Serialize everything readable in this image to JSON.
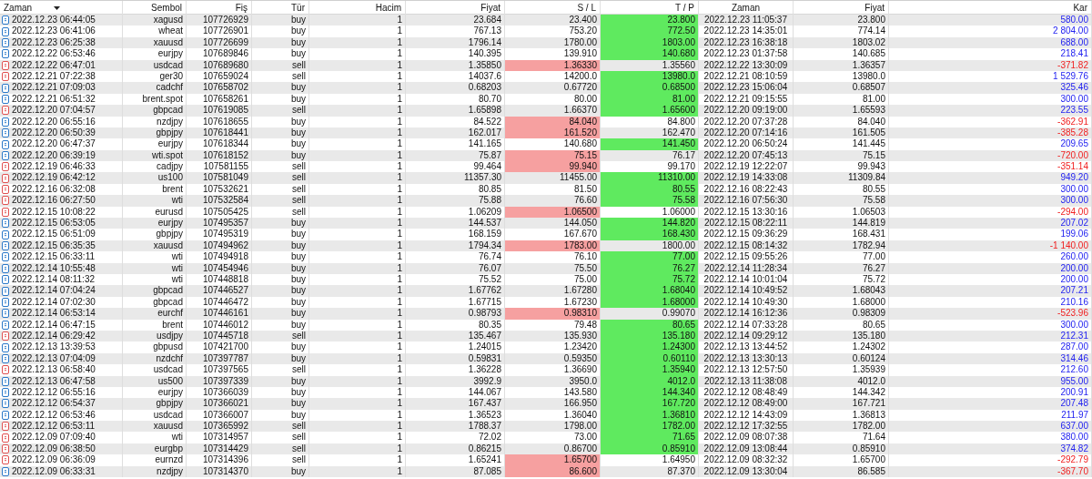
{
  "table": {
    "columns": [
      "Zaman",
      "Sembol",
      "Fiş",
      "Tür",
      "Hacim",
      "Fiyat",
      "S / L",
      "T / P",
      "Zaman",
      "Fiyat",
      "Kar"
    ],
    "rows": [
      {
        "kind": "buy",
        "sl_hit": false,
        "tp_hit": true,
        "loss": false,
        "cells": [
          "2022.12.23 06:44:05",
          "xagusd",
          "107726929",
          "buy",
          "1",
          "23.684",
          "23.400",
          "23.800",
          "2022.12.23 11:05:37",
          "23.800",
          "580.00"
        ]
      },
      {
        "kind": "buy",
        "sl_hit": false,
        "tp_hit": true,
        "loss": false,
        "cells": [
          "2022.12.23 06:41:06",
          "wheat",
          "107726901",
          "buy",
          "1",
          "767.13",
          "753.20",
          "772.50",
          "2022.12.23 14:35:01",
          "774.14",
          "2 804.00"
        ]
      },
      {
        "kind": "buy",
        "sl_hit": false,
        "tp_hit": true,
        "loss": false,
        "cells": [
          "2022.12.23 06:25:38",
          "xauusd",
          "107726699",
          "buy",
          "1",
          "1796.14",
          "1780.00",
          "1803.00",
          "2022.12.23 16:38:18",
          "1803.02",
          "688.00"
        ]
      },
      {
        "kind": "buy",
        "sl_hit": false,
        "tp_hit": true,
        "loss": false,
        "cells": [
          "2022.12.22 06:53:46",
          "eurjpy",
          "107689846",
          "buy",
          "1",
          "140.395",
          "139.910",
          "140.680",
          "2022.12.23 01:37:58",
          "140.685",
          "218.41"
        ]
      },
      {
        "kind": "sell",
        "sl_hit": true,
        "tp_hit": false,
        "loss": true,
        "cells": [
          "2022.12.22 06:47:01",
          "usdcad",
          "107689680",
          "sell",
          "1",
          "1.35850",
          "1.36330",
          "1.35560",
          "2022.12.22 13:30:09",
          "1.36357",
          "-371.82"
        ]
      },
      {
        "kind": "sell",
        "sl_hit": false,
        "tp_hit": true,
        "loss": false,
        "cells": [
          "2022.12.21 07:22:38",
          "ger30",
          "107659024",
          "sell",
          "1",
          "14037.6",
          "14200.0",
          "13980.0",
          "2022.12.21 08:10:59",
          "13980.0",
          "1 529.76"
        ]
      },
      {
        "kind": "buy",
        "sl_hit": false,
        "tp_hit": true,
        "loss": false,
        "cells": [
          "2022.12.21 07:09:03",
          "cadchf",
          "107658702",
          "buy",
          "1",
          "0.68203",
          "0.67720",
          "0.68500",
          "2022.12.23 15:06:04",
          "0.68507",
          "325.46"
        ]
      },
      {
        "kind": "buy",
        "sl_hit": false,
        "tp_hit": true,
        "loss": false,
        "cells": [
          "2022.12.21 06:51:32",
          "brent.spot",
          "107658261",
          "buy",
          "1",
          "80.70",
          "80.00",
          "81.00",
          "2022.12.21 09:15:55",
          "81.00",
          "300.00"
        ]
      },
      {
        "kind": "sell",
        "sl_hit": false,
        "tp_hit": true,
        "loss": false,
        "cells": [
          "2022.12.20 07:04:57",
          "gbpcad",
          "107619085",
          "sell",
          "1",
          "1.65898",
          "1.66370",
          "1.65600",
          "2022.12.20 09:19:00",
          "1.65593",
          "223.55"
        ]
      },
      {
        "kind": "buy",
        "sl_hit": true,
        "tp_hit": false,
        "loss": true,
        "cells": [
          "2022.12.20 06:55:16",
          "nzdjpy",
          "107618655",
          "buy",
          "1",
          "84.522",
          "84.040",
          "84.800",
          "2022.12.20 07:37:28",
          "84.040",
          "-362.91"
        ]
      },
      {
        "kind": "buy",
        "sl_hit": true,
        "tp_hit": false,
        "loss": true,
        "cells": [
          "2022.12.20 06:50:39",
          "gbpjpy",
          "107618441",
          "buy",
          "1",
          "162.017",
          "161.520",
          "162.470",
          "2022.12.20 07:14:16",
          "161.505",
          "-385.28"
        ]
      },
      {
        "kind": "buy",
        "sl_hit": false,
        "tp_hit": true,
        "loss": false,
        "cells": [
          "2022.12.20 06:47:37",
          "eurjpy",
          "107618344",
          "buy",
          "1",
          "141.165",
          "140.680",
          "141.450",
          "2022.12.20 06:50:24",
          "141.445",
          "209.65"
        ]
      },
      {
        "kind": "buy",
        "sl_hit": true,
        "tp_hit": false,
        "loss": true,
        "cells": [
          "2022.12.20 06:39:19",
          "wti.spot",
          "107618152",
          "buy",
          "1",
          "75.87",
          "75.15",
          "76.17",
          "2022.12.20 07:45:13",
          "75.15",
          "-720.00"
        ]
      },
      {
        "kind": "sell",
        "sl_hit": true,
        "tp_hit": false,
        "loss": true,
        "cells": [
          "2022.12.19 06:46:33",
          "cadjpy",
          "107581155",
          "sell",
          "1",
          "99.464",
          "99.940",
          "99.170",
          "2022.12.19 12:22:07",
          "99.943",
          "-351.14"
        ]
      },
      {
        "kind": "sell",
        "sl_hit": false,
        "tp_hit": true,
        "loss": false,
        "cells": [
          "2022.12.19 06:42:12",
          "us100",
          "107581049",
          "sell",
          "1",
          "11357.30",
          "11455.00",
          "11310.00",
          "2022.12.19 14:33:08",
          "11309.84",
          "949.20"
        ]
      },
      {
        "kind": "sell",
        "sl_hit": false,
        "tp_hit": true,
        "loss": false,
        "cells": [
          "2022.12.16 06:32:08",
          "brent",
          "107532621",
          "sell",
          "1",
          "80.85",
          "81.50",
          "80.55",
          "2022.12.16 08:22:43",
          "80.55",
          "300.00"
        ]
      },
      {
        "kind": "sell",
        "sl_hit": false,
        "tp_hit": true,
        "loss": false,
        "cells": [
          "2022.12.16 06:27:50",
          "wti",
          "107532584",
          "sell",
          "1",
          "75.88",
          "76.60",
          "75.58",
          "2022.12.16 07:56:30",
          "75.58",
          "300.00"
        ]
      },
      {
        "kind": "sell",
        "sl_hit": true,
        "tp_hit": false,
        "loss": true,
        "cells": [
          "2022.12.15 10:08:22",
          "eurusd",
          "107505425",
          "sell",
          "1",
          "1.06209",
          "1.06500",
          "1.06000",
          "2022.12.15 13:30:16",
          "1.06503",
          "-294.00"
        ]
      },
      {
        "kind": "buy",
        "sl_hit": false,
        "tp_hit": true,
        "loss": false,
        "cells": [
          "2022.12.15 06:53:05",
          "eurjpy",
          "107495357",
          "buy",
          "1",
          "144.537",
          "144.050",
          "144.820",
          "2022.12.15 08:22:11",
          "144.819",
          "207.02"
        ]
      },
      {
        "kind": "buy",
        "sl_hit": false,
        "tp_hit": true,
        "loss": false,
        "cells": [
          "2022.12.15 06:51:09",
          "gbpjpy",
          "107495319",
          "buy",
          "1",
          "168.159",
          "167.670",
          "168.430",
          "2022.12.15 09:36:29",
          "168.431",
          "199.06"
        ]
      },
      {
        "kind": "buy",
        "sl_hit": true,
        "tp_hit": false,
        "loss": true,
        "cells": [
          "2022.12.15 06:35:35",
          "xauusd",
          "107494962",
          "buy",
          "1",
          "1794.34",
          "1783.00",
          "1800.00",
          "2022.12.15 08:14:32",
          "1782.94",
          "-1 140.00"
        ]
      },
      {
        "kind": "buy",
        "sl_hit": false,
        "tp_hit": true,
        "loss": false,
        "cells": [
          "2022.12.15 06:33:11",
          "wti",
          "107494918",
          "buy",
          "1",
          "76.74",
          "76.10",
          "77.00",
          "2022.12.15 09:55:26",
          "77.00",
          "260.00"
        ]
      },
      {
        "kind": "buy",
        "sl_hit": false,
        "tp_hit": true,
        "loss": false,
        "cells": [
          "2022.12.14 10:55:48",
          "wti",
          "107454946",
          "buy",
          "1",
          "76.07",
          "75.50",
          "76.27",
          "2022.12.14 11:28:34",
          "76.27",
          "200.00"
        ]
      },
      {
        "kind": "buy",
        "sl_hit": false,
        "tp_hit": true,
        "loss": false,
        "cells": [
          "2022.12.14 08:11:32",
          "wti",
          "107448818",
          "buy",
          "1",
          "75.52",
          "75.00",
          "75.72",
          "2022.12.14 10:01:04",
          "75.72",
          "200.00"
        ]
      },
      {
        "kind": "buy",
        "sl_hit": false,
        "tp_hit": true,
        "loss": false,
        "cells": [
          "2022.12.14 07:04:24",
          "gbpcad",
          "107446527",
          "buy",
          "1",
          "1.67762",
          "1.67280",
          "1.68040",
          "2022.12.14 10:49:52",
          "1.68043",
          "207.21"
        ]
      },
      {
        "kind": "buy",
        "sl_hit": false,
        "tp_hit": true,
        "loss": false,
        "cells": [
          "2022.12.14 07:02:30",
          "gbpcad",
          "107446472",
          "buy",
          "1",
          "1.67715",
          "1.67230",
          "1.68000",
          "2022.12.14 10:49:30",
          "1.68000",
          "210.16"
        ]
      },
      {
        "kind": "buy",
        "sl_hit": true,
        "tp_hit": false,
        "loss": true,
        "cells": [
          "2022.12.14 06:53:14",
          "eurchf",
          "107446161",
          "buy",
          "1",
          "0.98793",
          "0.98310",
          "0.99070",
          "2022.12.14 16:12:36",
          "0.98309",
          "-523.96"
        ]
      },
      {
        "kind": "buy",
        "sl_hit": false,
        "tp_hit": true,
        "loss": false,
        "cells": [
          "2022.12.14 06:47:15",
          "brent",
          "107446012",
          "buy",
          "1",
          "80.35",
          "79.48",
          "80.65",
          "2022.12.14 07:33:28",
          "80.65",
          "300.00"
        ]
      },
      {
        "kind": "sell",
        "sl_hit": false,
        "tp_hit": true,
        "loss": false,
        "cells": [
          "2022.12.14 06:29:42",
          "usdjpy",
          "107445718",
          "sell",
          "1",
          "135.467",
          "135.930",
          "135.180",
          "2022.12.14 09:29:12",
          "135.180",
          "212.31"
        ]
      },
      {
        "kind": "buy",
        "sl_hit": false,
        "tp_hit": true,
        "loss": false,
        "cells": [
          "2022.12.13 13:39:53",
          "gbpusd",
          "107421700",
          "buy",
          "1",
          "1.24015",
          "1.23420",
          "1.24300",
          "2022.12.13 13:44:52",
          "1.24302",
          "287.00"
        ]
      },
      {
        "kind": "buy",
        "sl_hit": false,
        "tp_hit": true,
        "loss": false,
        "cells": [
          "2022.12.13 07:04:09",
          "nzdchf",
          "107397787",
          "buy",
          "1",
          "0.59831",
          "0.59350",
          "0.60110",
          "2022.12.13 13:30:13",
          "0.60124",
          "314.46"
        ]
      },
      {
        "kind": "sell",
        "sl_hit": false,
        "tp_hit": true,
        "loss": false,
        "cells": [
          "2022.12.13 06:58:40",
          "usdcad",
          "107397565",
          "sell",
          "1",
          "1.36228",
          "1.36690",
          "1.35940",
          "2022.12.13 12:57:50",
          "1.35939",
          "212.60"
        ]
      },
      {
        "kind": "buy",
        "sl_hit": false,
        "tp_hit": true,
        "loss": false,
        "cells": [
          "2022.12.13 06:47:58",
          "us500",
          "107397339",
          "buy",
          "1",
          "3992.9",
          "3950.0",
          "4012.0",
          "2022.12.13 11:38:08",
          "4012.0",
          "955.00"
        ]
      },
      {
        "kind": "buy",
        "sl_hit": false,
        "tp_hit": true,
        "loss": false,
        "cells": [
          "2022.12.12 06:55:16",
          "eurjpy",
          "107366039",
          "buy",
          "1",
          "144.067",
          "143.580",
          "144.340",
          "2022.12.12 08:48:49",
          "144.342",
          "200.91"
        ]
      },
      {
        "kind": "buy",
        "sl_hit": false,
        "tp_hit": true,
        "loss": false,
        "cells": [
          "2022.12.12 06:54:37",
          "gbpjpy",
          "107366021",
          "buy",
          "1",
          "167.437",
          "166.950",
          "167.720",
          "2022.12.12 08:49:00",
          "167.721",
          "207.48"
        ]
      },
      {
        "kind": "buy",
        "sl_hit": false,
        "tp_hit": true,
        "loss": false,
        "cells": [
          "2022.12.12 06:53:46",
          "usdcad",
          "107366007",
          "buy",
          "1",
          "1.36523",
          "1.36040",
          "1.36810",
          "2022.12.12 14:43:09",
          "1.36813",
          "211.97"
        ]
      },
      {
        "kind": "sell",
        "sl_hit": false,
        "tp_hit": true,
        "loss": false,
        "cells": [
          "2022.12.12 06:53:11",
          "xauusd",
          "107365992",
          "sell",
          "1",
          "1788.37",
          "1798.00",
          "1782.00",
          "2022.12.12 17:32:55",
          "1782.00",
          "637.00"
        ]
      },
      {
        "kind": "sell",
        "sl_hit": false,
        "tp_hit": true,
        "loss": false,
        "cells": [
          "2022.12.09 07:09:40",
          "wti",
          "107314957",
          "sell",
          "1",
          "72.02",
          "73.00",
          "71.65",
          "2022.12.09 08:07:38",
          "71.64",
          "380.00"
        ]
      },
      {
        "kind": "sell",
        "sl_hit": false,
        "tp_hit": true,
        "loss": false,
        "cells": [
          "2022.12.09 06:38:50",
          "eurgbp",
          "107314429",
          "sell",
          "1",
          "0.86215",
          "0.86700",
          "0.85910",
          "2022.12.09 13:08:44",
          "0.85910",
          "374.82"
        ]
      },
      {
        "kind": "sell",
        "sl_hit": true,
        "tp_hit": false,
        "loss": true,
        "cells": [
          "2022.12.09 06:36:09",
          "eurnzd",
          "107314396",
          "sell",
          "1",
          "1.65241",
          "1.65700",
          "1.64950",
          "2022.12.09 08:32:32",
          "1.65700",
          "-292.79"
        ]
      },
      {
        "kind": "buy",
        "sl_hit": true,
        "tp_hit": false,
        "loss": true,
        "cells": [
          "2022.12.09 06:33:31",
          "nzdjpy",
          "107314370",
          "buy",
          "1",
          "87.085",
          "86.600",
          "87.370",
          "2022.12.09 13:30:04",
          "86.585",
          "-367.70"
        ]
      }
    ]
  }
}
